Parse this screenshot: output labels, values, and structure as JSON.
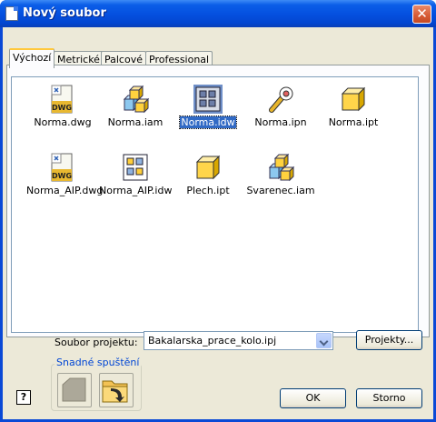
{
  "window": {
    "title": "Nový soubor",
    "close_label": "✕"
  },
  "tabs": [
    {
      "label": "Výchozí",
      "active": true
    },
    {
      "label": "Metrické",
      "active": false
    },
    {
      "label": "Palcové",
      "active": false
    },
    {
      "label": "Professional",
      "active": false
    }
  ],
  "files": [
    {
      "name": "Norma.dwg",
      "icon": "dwg-icon",
      "selected": false
    },
    {
      "name": "Norma.iam",
      "icon": "assembly-icon",
      "selected": false
    },
    {
      "name": "Norma.idw",
      "icon": "drawing-icon",
      "selected": true
    },
    {
      "name": "Norma.ipn",
      "icon": "presentation-icon",
      "selected": false
    },
    {
      "name": "Norma.ipt",
      "icon": "part-icon",
      "selected": false
    },
    {
      "name": "Norma_AIP.dwg",
      "icon": "dwg-icon",
      "selected": false
    },
    {
      "name": "Norma_AIP.idw",
      "icon": "drawing-icon",
      "selected": false
    },
    {
      "name": "Plech.ipt",
      "icon": "part-icon",
      "selected": false
    },
    {
      "name": "Svarenec.iam",
      "icon": "assembly-icon",
      "selected": false
    }
  ],
  "project": {
    "label": "Soubor projektu:",
    "value": "Bakalarska_prace_kolo.ipj",
    "projects_button": "Projekty..."
  },
  "quick_launch": {
    "legend": "Snadné spuštění"
  },
  "buttons": {
    "ok": "OK",
    "cancel": "Storno",
    "help": "?"
  },
  "colors": {
    "title_bar": "#0551e0",
    "selection": "#316ac5",
    "dialog_bg": "#ece9d8"
  }
}
